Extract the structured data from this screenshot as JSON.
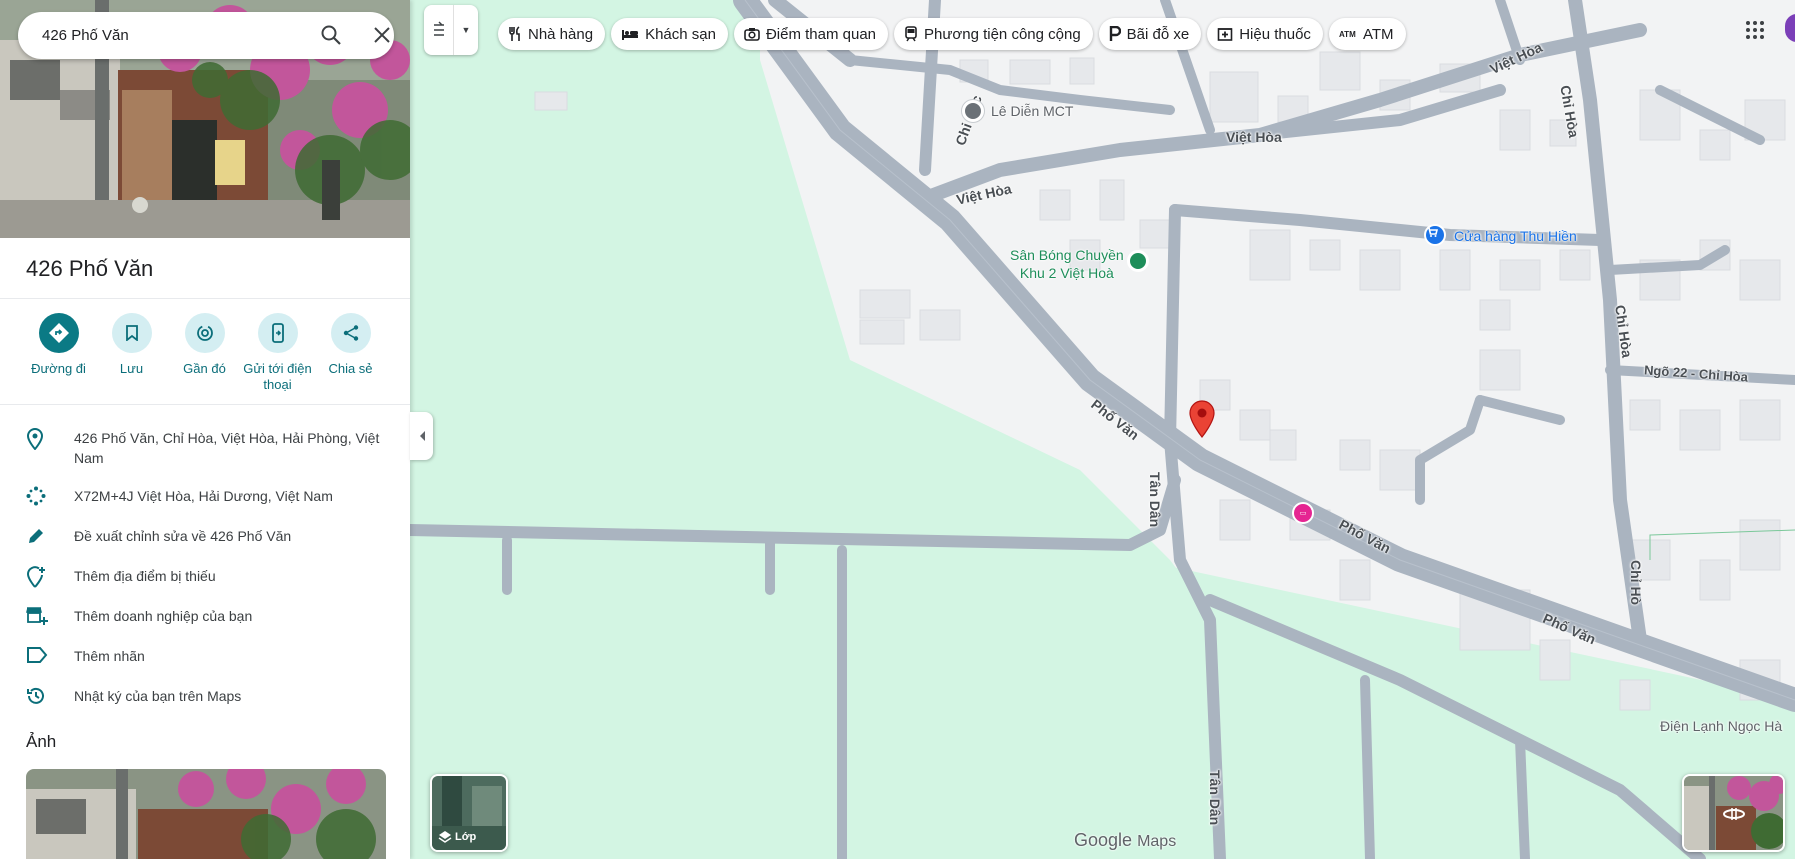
{
  "search": {
    "value": "426 Phố Văn",
    "search_icon": "search-icon",
    "close_icon": "close-icon"
  },
  "place": {
    "title": "426 Phố Văn"
  },
  "actions": [
    {
      "label": "Đường đi",
      "icon": "directions-icon"
    },
    {
      "label": "Lưu",
      "icon": "bookmark-icon"
    },
    {
      "label": "Gần đó",
      "icon": "nearby-icon"
    },
    {
      "label": "Gửi tới điện thoại",
      "icon": "send-to-phone-icon"
    },
    {
      "label": "Chia sẻ",
      "icon": "share-icon"
    }
  ],
  "info": [
    {
      "text": "426 Phố Văn, Chỉ Hòa, Việt Hòa, Hải Phòng, Việt Nam",
      "icon": "location-pin-icon"
    },
    {
      "text": "X72M+4J Việt Hòa, Hải Dương, Việt Nam",
      "icon": "plus-code-icon"
    },
    {
      "text": "Đề xuất chỉnh sửa về 426 Phố Văn",
      "icon": "edit-pencil-icon"
    },
    {
      "text": "Thêm địa điểm bị thiếu",
      "icon": "add-place-icon"
    },
    {
      "text": "Thêm doanh nghiệp của bạn",
      "icon": "add-business-icon"
    },
    {
      "text": "Thêm nhãn",
      "icon": "label-icon"
    },
    {
      "text": "Nhật ký của bạn trên Maps",
      "icon": "history-icon"
    }
  ],
  "photos": {
    "heading": "Ảnh"
  },
  "chips": [
    {
      "label": "Nhà hàng",
      "icon": "restaurant-icon"
    },
    {
      "label": "Khách sạn",
      "icon": "hotel-icon"
    },
    {
      "label": "Điểm tham quan",
      "icon": "camera-icon"
    },
    {
      "label": "Phương tiện công cộng",
      "icon": "transit-icon"
    },
    {
      "label": "Bãi đỗ xe",
      "icon": "parking-icon"
    },
    {
      "label": "Hiệu thuốc",
      "icon": "pharmacy-icon"
    },
    {
      "label": "ATM",
      "icon": "atm-icon"
    }
  ],
  "map": {
    "roads": {
      "viet_hoa_1": "Việt Hòa",
      "viet_hoa_2": "Việt Hòa",
      "viet_hoa_3": "Việt Hòa",
      "chi_cac": "Chi Các",
      "chi_hoa_1": "Chỉ Hòa",
      "chi_hoa_2": "Chỉ Hòa",
      "ngo_22": "Ngõ 22 - Chỉ Hòa",
      "pho_van_1": "Phố Văn",
      "pho_van_2": "Phố Văn",
      "pho_van_3": "Phố Văn",
      "tan_dan_1": "Tân Dân",
      "tan_dan_2": "Tân Dân",
      "chi_ho": "Chỉ Hò"
    },
    "pois": {
      "le_dien": "Lê Diễn MCT",
      "san_bong_1": "Sân Bóng Chuyền",
      "san_bong_2": "Khu 2 Việt Hoà",
      "cua_hang": "Cửa hàng Thu Hiền",
      "dien_lanh": "Điện Lạnh Ngọc Hà"
    },
    "layers_label": "Lớp",
    "logo_google": "Google",
    "logo_maps": "Maps",
    "colors": {
      "road": "#aab4c0",
      "park": "#d3f5e3",
      "building": "#e8eaed",
      "accent": "#0b7a85",
      "pin": "#ea4335"
    }
  }
}
